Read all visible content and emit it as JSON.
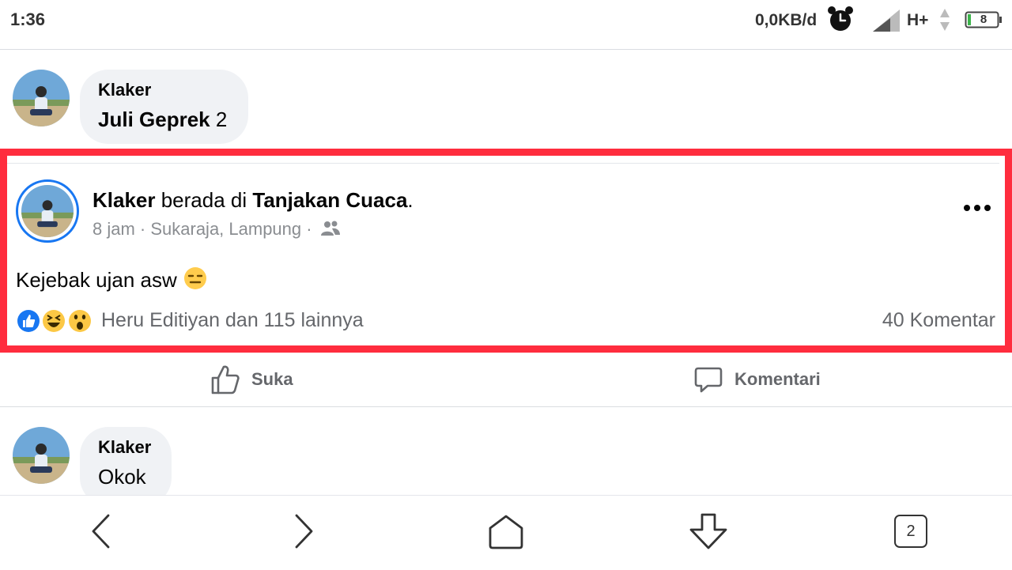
{
  "status_bar": {
    "time": "1:36",
    "network_speed": "0,0KB/d",
    "network_type": "H+",
    "battery_level": "8",
    "icons": [
      "alarm-icon",
      "signal-icon",
      "data-arrows-icon",
      "battery-icon"
    ]
  },
  "comments": [
    {
      "author": "Klaker",
      "text": "Juli Geprek",
      "suffix": " 2"
    },
    {
      "author": "Klaker",
      "text": "Okok"
    }
  ],
  "post": {
    "author": "Klaker",
    "verb": " berada di ",
    "place": "Tanjakan Cuaca",
    "place_suffix": ".",
    "meta": "8 jam · Sukaraja, Lampung ·",
    "audience_icon": "friends-icon",
    "body": "Kejebak ujan asw",
    "body_emoji": "expressionless-face",
    "reactions": [
      "like",
      "haha",
      "wow"
    ],
    "reaction_summary": "Heru Editiyan dan 115 lainnya",
    "comment_count": "40 Komentar"
  },
  "actions": {
    "like_label": "Suka",
    "comment_label": "Komentari"
  },
  "bottom_nav": {
    "icons": [
      "back-icon",
      "forward-icon",
      "home-icon",
      "download-icon",
      "tabs-icon"
    ],
    "tab_count": "2"
  },
  "colors": {
    "highlight": "#ff2d3e",
    "facebook_blue": "#1877f2",
    "bubble_bg": "#f0f2f5",
    "secondary_text": "#65676b"
  }
}
